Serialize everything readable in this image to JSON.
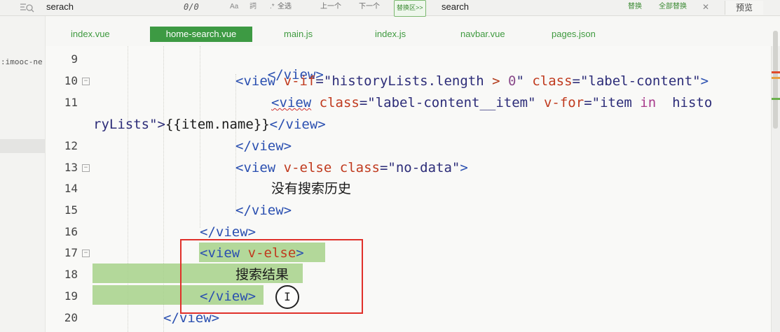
{
  "find_bar": {
    "search_value": "serach",
    "match_count": "0/0",
    "case_icon_text": "Aa",
    "word_icon_text": "詞",
    "regex_icon_text": ".*",
    "select_all": "全选",
    "prev": "上一个",
    "next": "下一个",
    "replace_zone": "替换区>>",
    "replace_value": "search",
    "replace": "替换",
    "replace_all": "全部替换",
    "close": "✕"
  },
  "preview_button": "预览",
  "left_panel": {
    "project_label": ":imooc-ne"
  },
  "tabs": [
    "index.vue",
    "home-search.vue",
    "main.js",
    "index.js",
    "navbar.vue",
    "pages.json"
  ],
  "active_tab": "home-search.vue",
  "line_numbers": [
    "9",
    "10",
    "11",
    "12",
    "13",
    "14",
    "15",
    "16",
    "17",
    "18",
    "19",
    "20"
  ],
  "code": {
    "l9_close": "</view>",
    "l10_open": "<view",
    "l10_attr": "v-if",
    "l10_eq": "=\"",
    "l10_var": "historyLists",
    "l10_dot": ".length",
    "l10_gt": " > ",
    "l10_zero": "0",
    "l10_q": "\" ",
    "l10_class": "class",
    "l10_val": "=\"label-content\"",
    "l10_end": ">",
    "l11_open": "<view",
    "l11_class": "class",
    "l11_val": "=\"label-content__item\"",
    "l11_for": "v-for",
    "l11_forval": "=\"item",
    "l11_in": "in",
    "l11_tail": "histo",
    "l11b_a": "ryLists\">",
    "l11b_b": "{{item.name}}",
    "l11b_c": "</view>",
    "l12": "</view>",
    "l13_open": "<view",
    "l13_attr": "v-else",
    "l13_class": "class",
    "l13_val": "=\"no-data\"",
    "l13_end": ">",
    "l14": "没有搜索历史",
    "l15": "</view>",
    "l16": "</view>",
    "l17_open": "<view",
    "l17_attr": "v-else",
    "l17_end": ">",
    "l18": "搜索结果",
    "l19": "</view>",
    "l20": "</view>"
  },
  "cursor_glyph": "I",
  "colors": {
    "tab_active_bg": "#3d9a43",
    "tab_text": "#3f9a3f",
    "selection": "#a7d28a",
    "annotation_box": "#e0302a"
  }
}
